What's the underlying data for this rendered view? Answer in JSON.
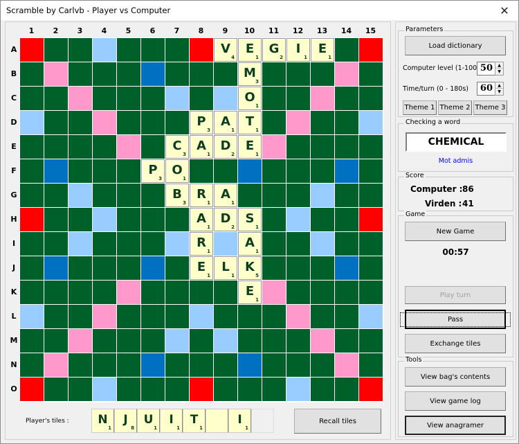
{
  "window": {
    "title": "Scramble by Carlvb - Player vs Computer",
    "close_icon": "✕"
  },
  "board": {
    "columns": [
      "1",
      "2",
      "3",
      "4",
      "5",
      "6",
      "7",
      "8",
      "9",
      "10",
      "11",
      "12",
      "13",
      "14",
      "15"
    ],
    "rows": [
      "A",
      "B",
      "C",
      "D",
      "E",
      "F",
      "G",
      "H",
      "I",
      "J",
      "K",
      "L",
      "M",
      "N",
      "O"
    ],
    "premium_colors": {
      "g": "#006029",
      "tw": "#ff0000",
      "dw": "#ff99cc",
      "dl": "#99ccff",
      "tl": "#0070c0",
      "tile": "#ffffcc"
    },
    "layout": [
      [
        "tw",
        "g",
        "g",
        "dl",
        "g",
        "g",
        "g",
        "tw",
        "g",
        "g",
        "g",
        "dl",
        "g",
        "g",
        "tw"
      ],
      [
        "g",
        "dw",
        "g",
        "g",
        "g",
        "tl",
        "g",
        "g",
        "g",
        "tl",
        "g",
        "g",
        "g",
        "dw",
        "g"
      ],
      [
        "g",
        "g",
        "dw",
        "g",
        "g",
        "g",
        "dl",
        "g",
        "dl",
        "g",
        "g",
        "g",
        "dw",
        "g",
        "g"
      ],
      [
        "dl",
        "g",
        "g",
        "dw",
        "g",
        "g",
        "g",
        "dl",
        "g",
        "g",
        "g",
        "dw",
        "g",
        "g",
        "dl"
      ],
      [
        "g",
        "g",
        "g",
        "g",
        "dw",
        "g",
        "g",
        "g",
        "g",
        "g",
        "dw",
        "g",
        "g",
        "g",
        "g"
      ],
      [
        "g",
        "tl",
        "g",
        "g",
        "g",
        "tl",
        "g",
        "g",
        "g",
        "tl",
        "g",
        "g",
        "g",
        "tl",
        "g"
      ],
      [
        "g",
        "g",
        "dl",
        "g",
        "g",
        "g",
        "dl",
        "g",
        "dl",
        "g",
        "g",
        "g",
        "dl",
        "g",
        "g"
      ],
      [
        "tw",
        "g",
        "g",
        "dl",
        "g",
        "g",
        "g",
        "dw",
        "g",
        "g",
        "g",
        "dl",
        "g",
        "g",
        "tw"
      ],
      [
        "g",
        "g",
        "dl",
        "g",
        "g",
        "g",
        "dl",
        "g",
        "dl",
        "g",
        "g",
        "g",
        "dl",
        "g",
        "g"
      ],
      [
        "g",
        "tl",
        "g",
        "g",
        "g",
        "tl",
        "g",
        "g",
        "g",
        "tl",
        "g",
        "g",
        "g",
        "tl",
        "g"
      ],
      [
        "g",
        "g",
        "g",
        "g",
        "dw",
        "g",
        "g",
        "g",
        "g",
        "g",
        "dw",
        "g",
        "g",
        "g",
        "g"
      ],
      [
        "dl",
        "g",
        "g",
        "dw",
        "g",
        "g",
        "g",
        "dl",
        "g",
        "g",
        "g",
        "dw",
        "g",
        "g",
        "dl"
      ],
      [
        "g",
        "g",
        "dw",
        "g",
        "g",
        "g",
        "dl",
        "g",
        "dl",
        "g",
        "g",
        "g",
        "dw",
        "g",
        "g"
      ],
      [
        "g",
        "dw",
        "g",
        "g",
        "g",
        "tl",
        "g",
        "g",
        "g",
        "tl",
        "g",
        "g",
        "g",
        "dw",
        "g"
      ],
      [
        "tw",
        "g",
        "g",
        "dl",
        "g",
        "g",
        "g",
        "tw",
        "g",
        "g",
        "g",
        "dl",
        "g",
        "g",
        "tw"
      ]
    ],
    "tiles": [
      {
        "row": "A",
        "col": 9,
        "letter": "V",
        "points": 4
      },
      {
        "row": "A",
        "col": 10,
        "letter": "E",
        "points": 1
      },
      {
        "row": "A",
        "col": 11,
        "letter": "G",
        "points": 2
      },
      {
        "row": "A",
        "col": 12,
        "letter": "I",
        "points": 1
      },
      {
        "row": "A",
        "col": 13,
        "letter": "E",
        "points": 1
      },
      {
        "row": "B",
        "col": 10,
        "letter": "M",
        "points": 3
      },
      {
        "row": "C",
        "col": 10,
        "letter": "O",
        "points": 1
      },
      {
        "row": "D",
        "col": 8,
        "letter": "P",
        "points": 3
      },
      {
        "row": "D",
        "col": 9,
        "letter": "A",
        "points": 1
      },
      {
        "row": "D",
        "col": 10,
        "letter": "T",
        "points": 1
      },
      {
        "row": "E",
        "col": 7,
        "letter": "C",
        "points": 3
      },
      {
        "row": "E",
        "col": 8,
        "letter": "A",
        "points": 1
      },
      {
        "row": "E",
        "col": 9,
        "letter": "D",
        "points": 2
      },
      {
        "row": "E",
        "col": 10,
        "letter": "E",
        "points": 1
      },
      {
        "row": "F",
        "col": 6,
        "letter": "P",
        "points": 3
      },
      {
        "row": "F",
        "col": 7,
        "letter": "O",
        "points": 1
      },
      {
        "row": "G",
        "col": 7,
        "letter": "B",
        "points": 3
      },
      {
        "row": "G",
        "col": 8,
        "letter": "R",
        "points": 1
      },
      {
        "row": "G",
        "col": 9,
        "letter": "A",
        "points": 1
      },
      {
        "row": "H",
        "col": 8,
        "letter": "A",
        "points": 1
      },
      {
        "row": "H",
        "col": 9,
        "letter": "D",
        "points": 2
      },
      {
        "row": "H",
        "col": 10,
        "letter": "S",
        "points": 1
      },
      {
        "row": "I",
        "col": 8,
        "letter": "R",
        "points": 1
      },
      {
        "row": "I",
        "col": 10,
        "letter": "A",
        "points": 1
      },
      {
        "row": "J",
        "col": 8,
        "letter": "E",
        "points": 1
      },
      {
        "row": "J",
        "col": 9,
        "letter": "L",
        "points": 1
      },
      {
        "row": "J",
        "col": 10,
        "letter": "K",
        "points": 5
      },
      {
        "row": "K",
        "col": 10,
        "letter": "E",
        "points": 1
      }
    ]
  },
  "rack": {
    "label": "Player's tiles :",
    "tiles": [
      {
        "letter": "N",
        "points": "1"
      },
      {
        "letter": "J",
        "points": "8"
      },
      {
        "letter": "U",
        "points": "1"
      },
      {
        "letter": "I",
        "points": "1"
      },
      {
        "letter": "T",
        "points": "1"
      },
      {
        "letter": "",
        "points": ""
      },
      {
        "letter": "I",
        "points": "1"
      },
      {
        "empty": true
      }
    ],
    "recall_label": "Recall tiles"
  },
  "parameters": {
    "group_label": "Parameters",
    "load_dictionary": "Load dictionary",
    "computer_level_label": "Computer level (1-100)",
    "computer_level_value": "50",
    "time_turn_label": "Time/turn (0 - 180s)",
    "time_turn_value": "60",
    "themes": [
      "Theme 1",
      "Theme 2",
      "Theme 3"
    ]
  },
  "checking": {
    "group_label": "Checking a word",
    "word": "CHEMICAL",
    "status": "Mot admis",
    "status_color": "#0000ff"
  },
  "score": {
    "group_label": "Score",
    "computer_label": "Computer :",
    "computer_value": "86",
    "player_label": "Virden :",
    "player_value": "41"
  },
  "game": {
    "group_label": "Game",
    "new_game": "New Game",
    "timer": "00:57",
    "play_turn": "Play turn",
    "pass": "Pass",
    "exchange": "Exchange tiles"
  },
  "tools": {
    "group_label": "Tools",
    "view_bag": "View bag's contents",
    "view_log": "View game log",
    "view_anagramer": "View anagramer"
  }
}
